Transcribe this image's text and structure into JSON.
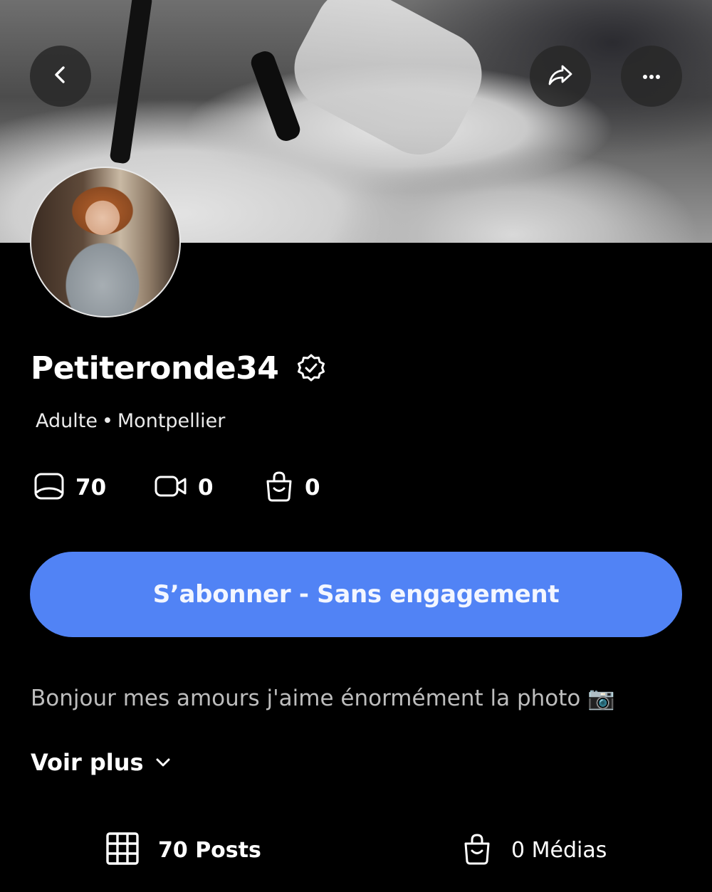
{
  "header": {
    "back_icon": "chevron-left-icon",
    "share_icon": "share-arrow-icon",
    "more_icon": "more-horizontal-icon"
  },
  "profile": {
    "username": "Petiteronde34",
    "category": "Adulte",
    "separator": "•",
    "location": "Montpellier",
    "verified": true
  },
  "stats": [
    {
      "icon": "image-icon",
      "value": "70"
    },
    {
      "icon": "video-icon",
      "value": "0"
    },
    {
      "icon": "bag-icon",
      "value": "0"
    }
  ],
  "subscribe": {
    "label": "S’abonner - Sans engagement",
    "color": "#5183f5"
  },
  "bio": {
    "text": "Bonjour mes amours j'aime énormément la photo",
    "emoji": "📷",
    "see_more_label": "Voir plus"
  },
  "tabs": [
    {
      "icon": "grid-icon",
      "label": "70 Posts",
      "active": true
    },
    {
      "icon": "bag-icon",
      "label": "0 Médias",
      "active": false
    }
  ]
}
